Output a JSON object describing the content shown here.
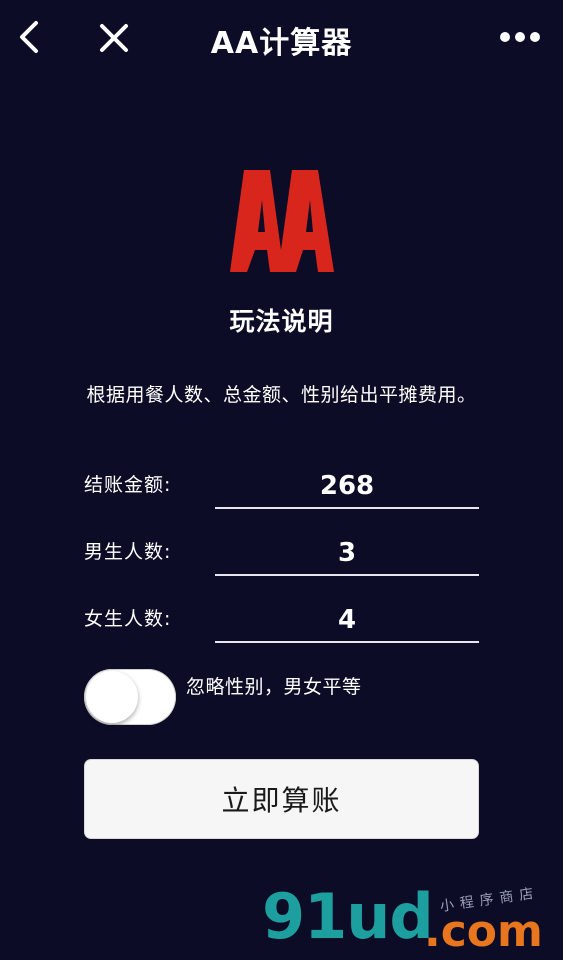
{
  "navbar": {
    "title": "AA计算器",
    "back_icon": "chevron-left-icon",
    "close_icon": "close-icon",
    "more_icon": "more-horizontal-icon"
  },
  "logo": {
    "text": "AA",
    "color": "#d9261c"
  },
  "intro": {
    "title": "玩法说明",
    "description": "根据用餐人数、总金额、性别给出平摊费用。"
  },
  "form": {
    "fields": [
      {
        "label": "结账金额:",
        "value": "268"
      },
      {
        "label": "男生人数:",
        "value": "3"
      },
      {
        "label": "女生人数:",
        "value": "4"
      }
    ],
    "toggle": {
      "label": "忽略性别，男女平等",
      "on": false
    },
    "submit_label": "立即算账"
  },
  "watermark": {
    "brand": "91ud",
    "suffix": ".com",
    "tagline": "小程序商店",
    "colors": {
      "primary": "#1d9fa0",
      "accent": "#e8761e"
    }
  },
  "colors": {
    "background": "#0d0c26",
    "text": "#ffffff"
  }
}
